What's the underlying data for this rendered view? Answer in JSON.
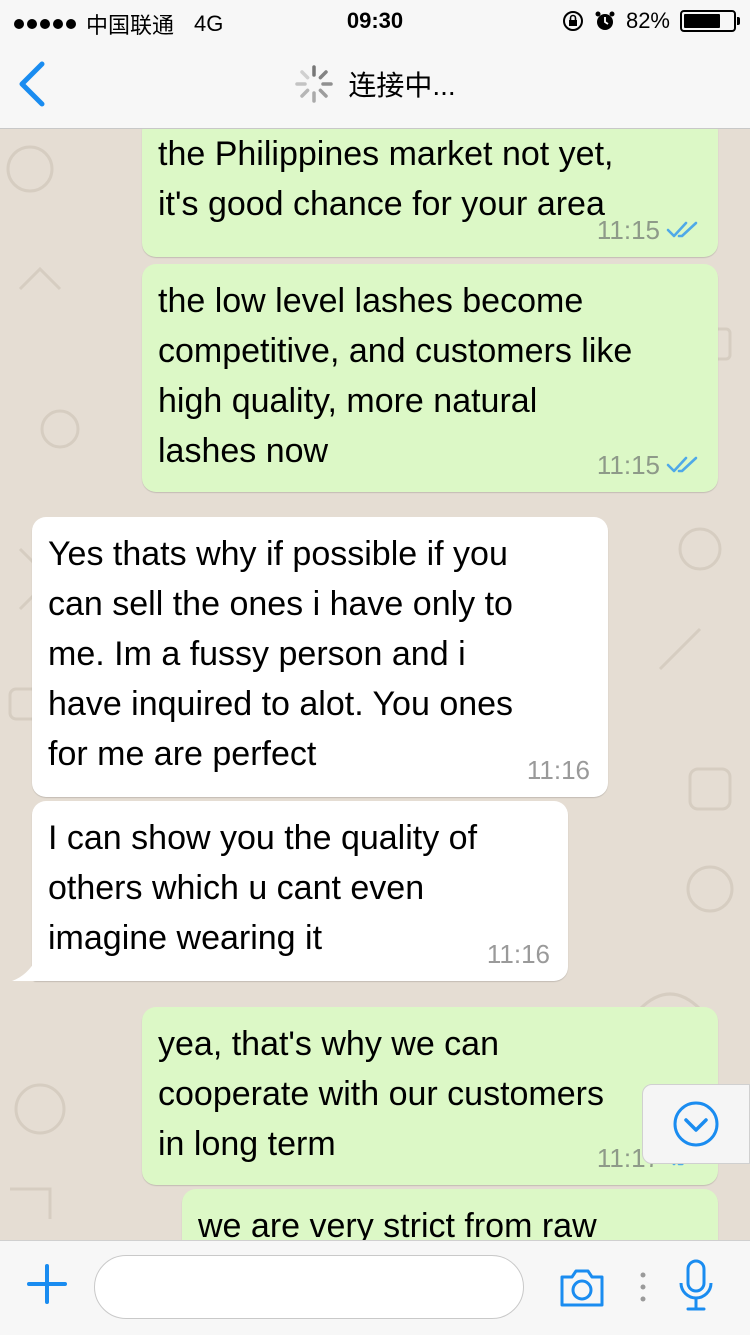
{
  "status_bar": {
    "carrier": "中国联通",
    "network": "4G",
    "time": "09:30",
    "battery_percent": "82%",
    "battery_level": 0.82
  },
  "nav": {
    "title": "连接中..."
  },
  "messages": [
    {
      "direction": "out",
      "lines": [
        "the Philippines market not yet,",
        "it's good chance for your area"
      ],
      "time": "11:15",
      "status": "read"
    },
    {
      "direction": "out",
      "lines": [
        "the low level lashes become",
        "competitive, and customers like",
        "high quality, more natural",
        "lashes now"
      ],
      "time": "11:15",
      "status": "read"
    },
    {
      "direction": "in",
      "lines": [
        "Yes thats why if possible if you",
        "can sell the ones i have only to",
        "me. Im a fussy person and i",
        "have inquired to alot. You ones",
        "for me are perfect"
      ],
      "time": "11:16"
    },
    {
      "direction": "in",
      "lines": [
        "I can show you the quality of",
        "others which u cant even",
        "imagine wearing it"
      ],
      "time": "11:16"
    },
    {
      "direction": "out",
      "lines": [
        "yea, that's why we can",
        "cooperate with our customers",
        "in long term"
      ],
      "time": "11:17",
      "status": "read"
    },
    {
      "direction": "out",
      "lines": [
        "we are very strict from raw"
      ],
      "time": "",
      "status": ""
    }
  ],
  "colors": {
    "accent": "#1a8cf0",
    "outgoing_bubble": "#dcf8c6",
    "incoming_bubble": "#ffffff",
    "chat_background": "#e5ddd3",
    "read_ticks": "#4fa9e8"
  },
  "icons": {
    "back": "back-chevron-icon",
    "spinner": "loading-spinner-icon",
    "scroll_down": "chevron-down-circle-icon",
    "add": "plus-icon",
    "camera": "camera-icon",
    "mic": "microphone-icon"
  },
  "composer": {
    "value": "",
    "placeholder": ""
  }
}
